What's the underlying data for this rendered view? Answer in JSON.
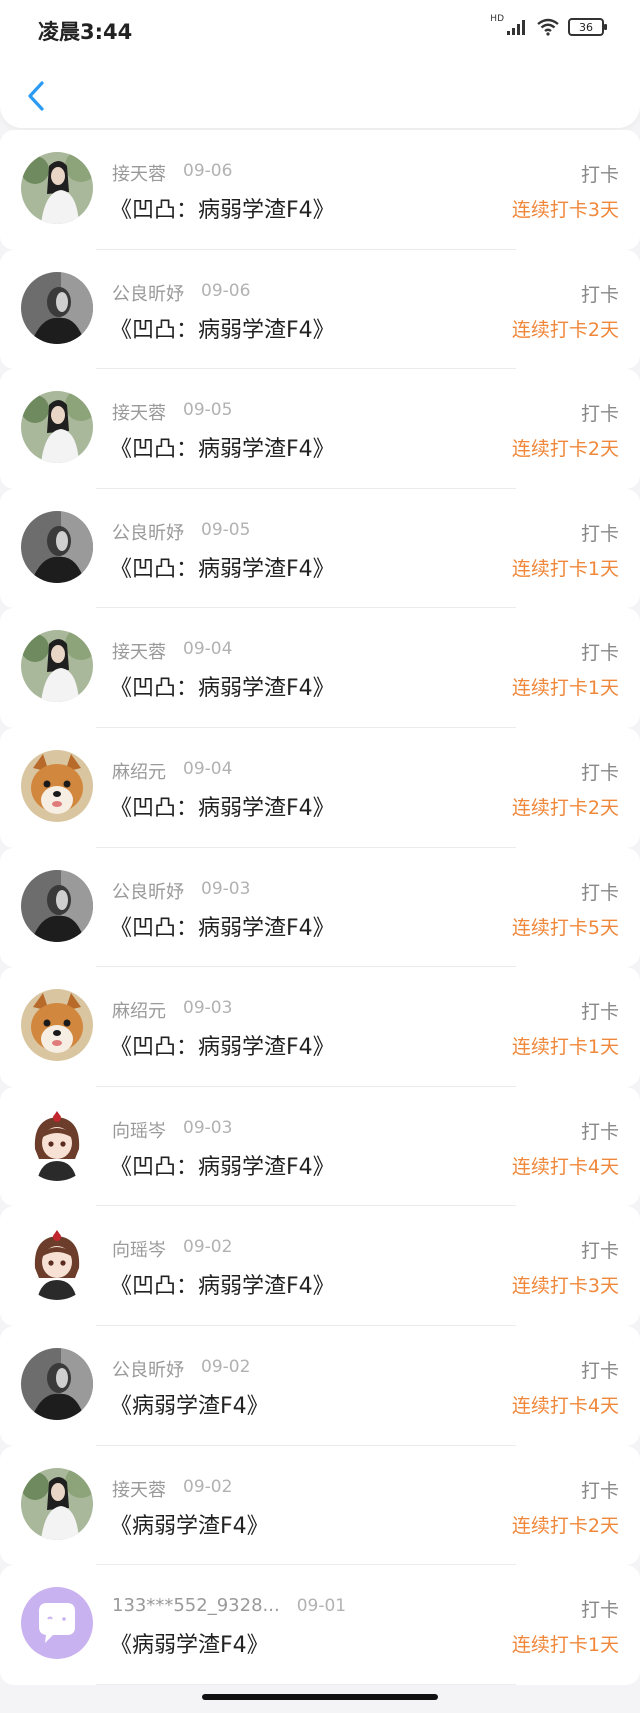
{
  "status_bar": {
    "time": "凌晨3:44",
    "network": "HD",
    "battery": "36"
  },
  "colors": {
    "accent_back": "#2b9af3",
    "streak_orange": "#f0883c"
  },
  "records": [
    {
      "user": "接天蓉",
      "date": "09-06",
      "title": "《凹凸：病弱学渣F4》",
      "label": "打卡",
      "streak": "连续打卡3天",
      "avatar": "girl"
    },
    {
      "user": "公良昕妤",
      "date": "09-06",
      "title": "《凹凸：病弱学渣F4》",
      "label": "打卡",
      "streak": "连续打卡2天",
      "avatar": "dark"
    },
    {
      "user": "接天蓉",
      "date": "09-05",
      "title": "《凹凸：病弱学渣F4》",
      "label": "打卡",
      "streak": "连续打卡2天",
      "avatar": "girl"
    },
    {
      "user": "公良昕妤",
      "date": "09-05",
      "title": "《凹凸：病弱学渣F4》",
      "label": "打卡",
      "streak": "连续打卡1天",
      "avatar": "dark"
    },
    {
      "user": "接天蓉",
      "date": "09-04",
      "title": "《凹凸：病弱学渣F4》",
      "label": "打卡",
      "streak": "连续打卡1天",
      "avatar": "girl"
    },
    {
      "user": "麻绍元",
      "date": "09-04",
      "title": "《凹凸：病弱学渣F4》",
      "label": "打卡",
      "streak": "连续打卡2天",
      "avatar": "dog"
    },
    {
      "user": "公良昕妤",
      "date": "09-03",
      "title": "《凹凸：病弱学渣F4》",
      "label": "打卡",
      "streak": "连续打卡5天",
      "avatar": "dark"
    },
    {
      "user": "麻绍元",
      "date": "09-03",
      "title": "《凹凸：病弱学渣F4》",
      "label": "打卡",
      "streak": "连续打卡1天",
      "avatar": "dog"
    },
    {
      "user": "向瑶岑",
      "date": "09-03",
      "title": "《凹凸：病弱学渣F4》",
      "label": "打卡",
      "streak": "连续打卡4天",
      "avatar": "anime"
    },
    {
      "user": "向瑶岑",
      "date": "09-02",
      "title": "《凹凸：病弱学渣F4》",
      "label": "打卡",
      "streak": "连续打卡3天",
      "avatar": "anime"
    },
    {
      "user": "公良昕妤",
      "date": "09-02",
      "title": "《病弱学渣F4》",
      "label": "打卡",
      "streak": "连续打卡4天",
      "avatar": "dark"
    },
    {
      "user": "接天蓉",
      "date": "09-02",
      "title": "《病弱学渣F4》",
      "label": "打卡",
      "streak": "连续打卡2天",
      "avatar": "girl"
    },
    {
      "user": "133***552_9328...",
      "date": "09-01",
      "title": "《病弱学渣F4》",
      "label": "打卡",
      "streak": "连续打卡1天",
      "avatar": "default"
    }
  ]
}
